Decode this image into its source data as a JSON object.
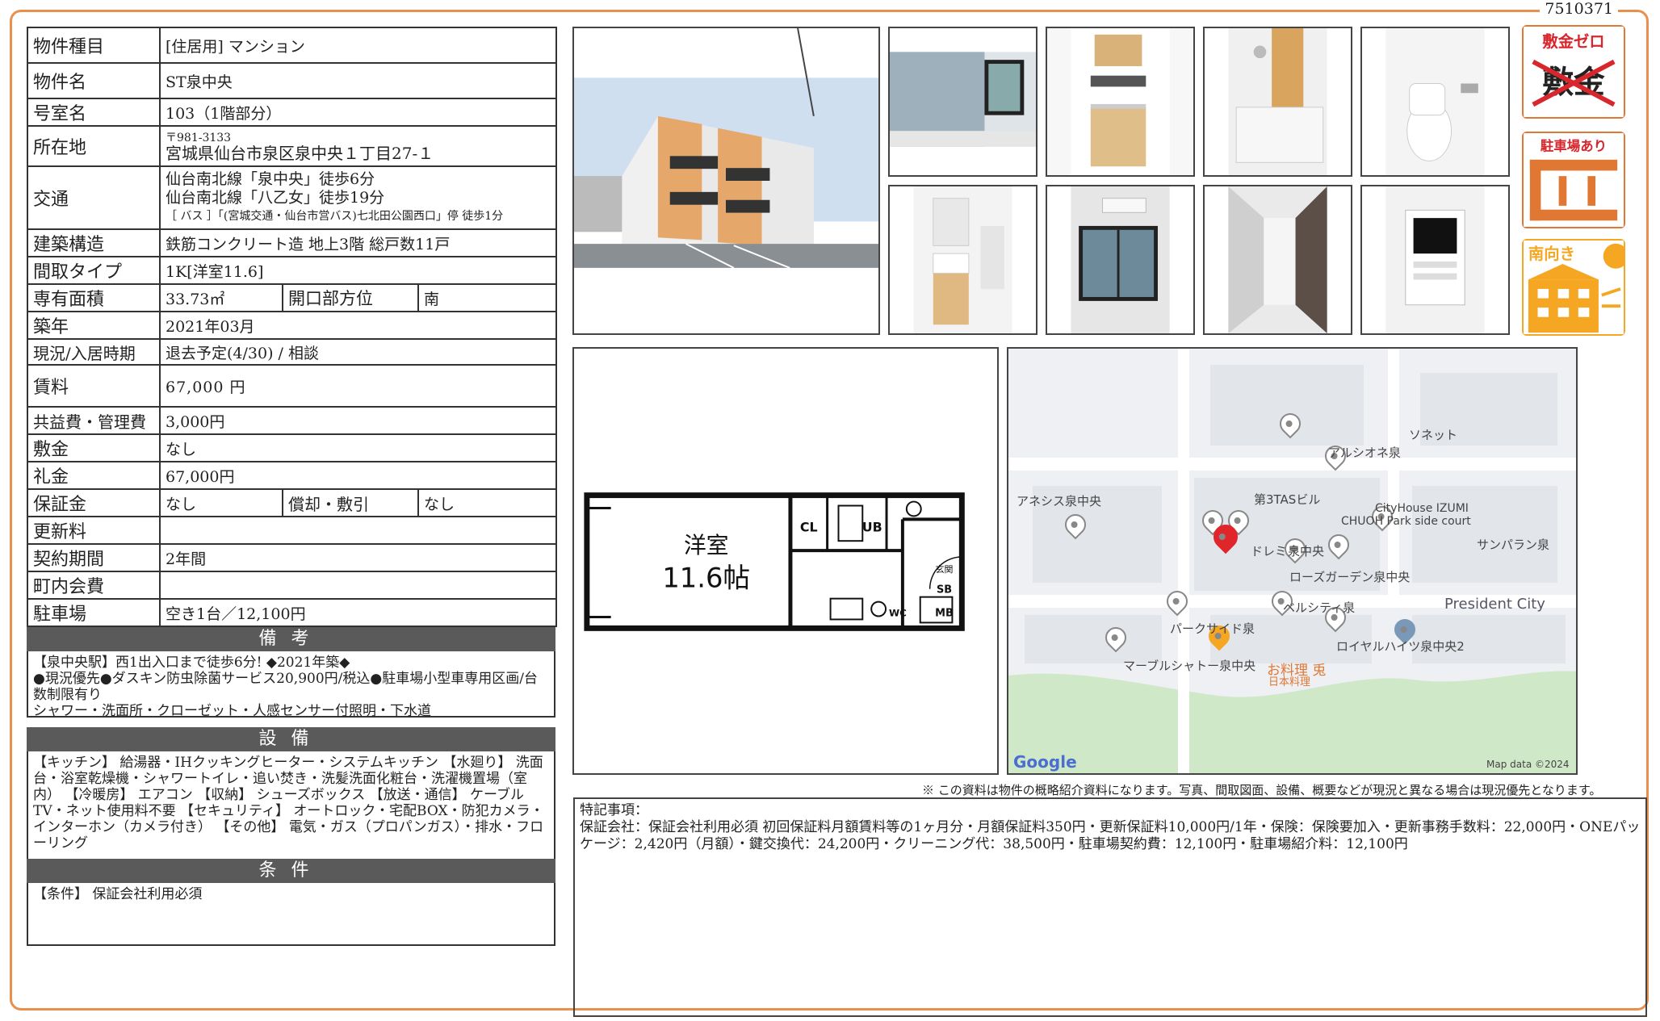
{
  "doc_id": "7510371",
  "spec": {
    "type_label": "物件種目",
    "type_value": "[住居用] マンション",
    "name_label": "物件名",
    "name_value": "ST泉中央",
    "room_label": "号室名",
    "room_value": "103（1階部分）",
    "addr_label": "所在地",
    "addr_zip": "〒981-3133",
    "addr_value": "宮城県仙台市泉区泉中央１丁目27-１",
    "access_label": "交通",
    "access_1": "仙台南北線「泉中央」徒歩6分",
    "access_2": "仙台南北線「八乙女」徒歩19分",
    "access_3": "［ バス ］「(宮城交通・仙台市営バス)七北田公園西口」停 徒歩1分",
    "struct_label": "建築構造",
    "struct_value": "鉄筋コンクリート造 地上3階 総戸数11戸",
    "layout_label": "間取タイプ",
    "layout_value": "1K[洋室11.6]",
    "area_label": "専有面積",
    "area_value": "33.73㎡",
    "dir_label": "開口部方位",
    "dir_value": "南",
    "built_label": "築年",
    "built_value": "2021年03月",
    "status_label": "現況/入居時期",
    "status_value": "退去予定(4/30) / 相談",
    "rent_label": "賃料",
    "rent_value": "67,000 円",
    "fee_label": "共益費・管理費",
    "fee_value": "3,000円",
    "deposit_label": "敷金",
    "deposit_value": "なし",
    "key_label": "礼金",
    "key_value": "67,000円",
    "guar_label": "保証金",
    "guar_value": "なし",
    "amort_label": "償却・敷引",
    "amort_value": "なし",
    "renew_label": "更新料",
    "renew_value": "",
    "term_label": "契約期間",
    "term_value": "2年間",
    "assoc_label": "町内会費",
    "assoc_value": "",
    "parking_label": "駐車場",
    "parking_value": "空き1台／12,100円"
  },
  "remarks": {
    "title": "備考",
    "line1": "【泉中央駅】西1出入口まで徒歩6分! ◆2021年築◆",
    "line2": "●現況優先●ダスキン防虫除菌サービス20,900円/税込●駐車場小型車専用区画/台数制限有り",
    "line3": "シャワー・洗面所・クローゼット・人感センサー付照明・下水道"
  },
  "equipment": {
    "title": "設備",
    "text": "【キッチン】 給湯器・IHクッキングヒーター・システムキッチン 【水廻り】 洗面台・浴室乾燥機・シャワートイレ・追い焚き・洗髪洗面化粧台・洗濯機置場（室内） 【冷暖房】 エアコン 【収納】 シューズボックス 【放送・通信】 ケーブルTV・ネット使用料不要 【セキュリティ】 オートロック・宅配BOX・防犯カメラ・インターホン（カメラ付き） 【その他】 電気・ガス（プロパンガス）・排水・フローリング"
  },
  "conditions": {
    "title": "条件",
    "text": "【条件】 保証会社利用必須"
  },
  "badges": {
    "deposit_zero": "敷金ゼロ",
    "deposit_crossed": "敷金",
    "parking": "駐車場あり",
    "south": "南向き"
  },
  "floorplan": {
    "room_name": "洋室",
    "room_size": "11.6帖",
    "cl": "CL",
    "ub": "UB",
    "genkan": "玄関",
    "sb": "SB",
    "wc": "WC",
    "mb": "MB"
  },
  "map": {
    "labels": [
      "ソネット",
      "アルシオネ泉",
      "アネシス泉中央",
      "第3TASビル",
      "CityHouse IZUMI",
      "CHUOH Park side court",
      "サンパラン泉",
      "ドレミ",
      "泉中央",
      "ローズガーデン泉中央",
      "パークサイド泉",
      "ベルシティ泉",
      "President City",
      "ロイヤルハイツ泉中央2",
      "マーブルシャトー泉中央",
      "お料理 兎",
      "日本料理"
    ],
    "google": "Google",
    "credit": "Map data ©2024"
  },
  "disclaimer": "※ この資料は物件の概略紹介資料になります。写真、間取図面、設備、概要などが現況と異なる場合は現況優先となります。",
  "special": {
    "title": "特記事項：",
    "text": "保証会社：保証会社利用必須 初回保証料月額賃料等の1ヶ月分・月額保証料350円・更新保証料10,000円/1年・保険：保険要加入・更新事務手数料：22,000円・ONEパッケージ：2,420円（月額）・鍵交換代：24,200円・クリーニング代：38,500円・駐車場契約費：12,100円・駐車場紹介料：12,100円"
  },
  "colors": {
    "frame": "#e8914f",
    "section": "#5a5a5a",
    "badge_red": "#d8262c",
    "badge_orange": "#f5a623",
    "pin_red": "#e0262b"
  }
}
